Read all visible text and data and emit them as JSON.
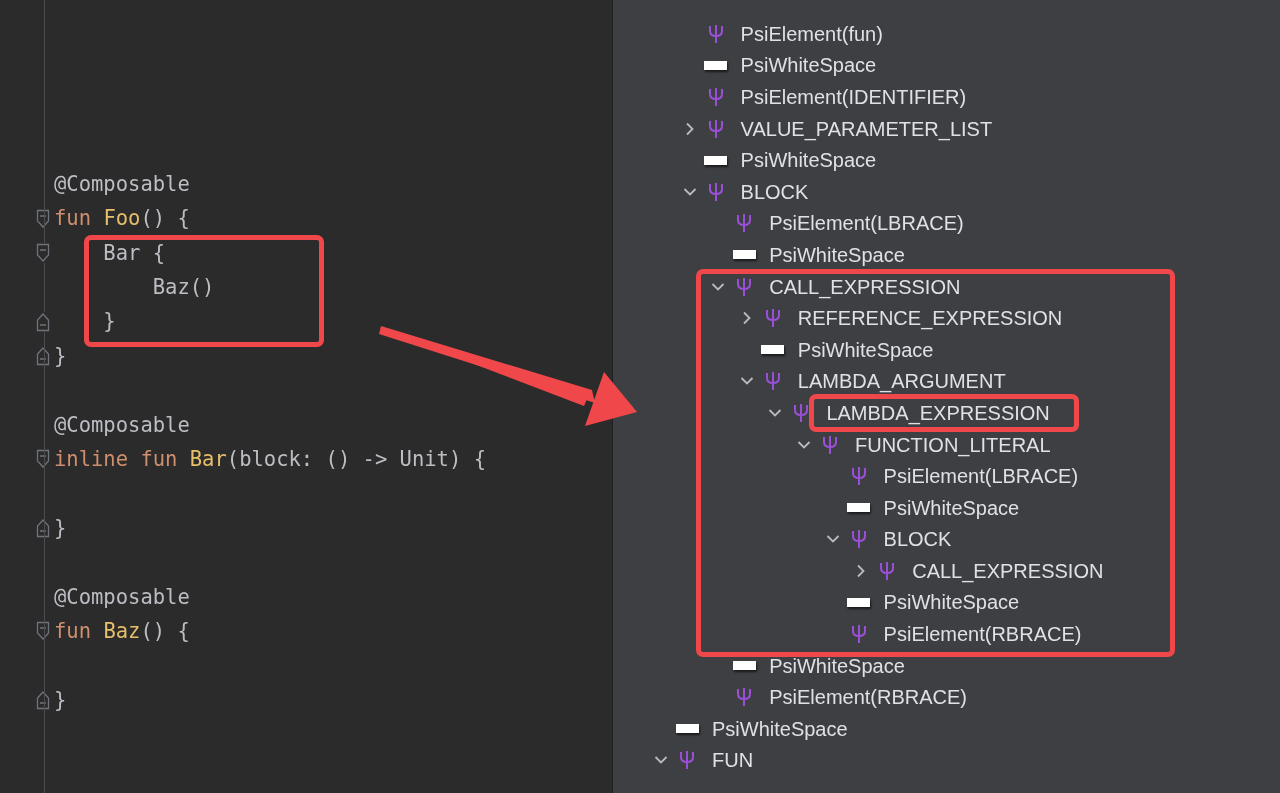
{
  "editor": {
    "lines": [
      {
        "kind": "code",
        "tokens": [
          {
            "text": "@Composable",
            "kind": "annotation"
          }
        ]
      },
      {
        "kind": "code",
        "fold_open": true,
        "tokens": [
          {
            "text": "fun ",
            "kind": "keyword"
          },
          {
            "text": "Foo",
            "kind": "function"
          },
          {
            "text": "() {",
            "kind": "plain"
          }
        ]
      },
      {
        "kind": "code",
        "fold_open": true,
        "highlighted": true,
        "tokens": [
          {
            "text": "    Bar {",
            "kind": "plain"
          }
        ]
      },
      {
        "kind": "code",
        "highlighted": true,
        "tokens": [
          {
            "text": "        Baz()",
            "kind": "plain"
          }
        ]
      },
      {
        "kind": "code",
        "fold_close": true,
        "highlighted": true,
        "tokens": [
          {
            "text": "    }",
            "kind": "plain"
          }
        ]
      },
      {
        "kind": "code",
        "fold_close": true,
        "tokens": [
          {
            "text": "}",
            "kind": "plain"
          }
        ]
      },
      {
        "kind": "blank"
      },
      {
        "kind": "code",
        "tokens": [
          {
            "text": "@Composable",
            "kind": "annotation"
          }
        ]
      },
      {
        "kind": "code",
        "fold_open": true,
        "tokens": [
          {
            "text": "inline fun ",
            "kind": "keyword"
          },
          {
            "text": "Bar",
            "kind": "function"
          },
          {
            "text": "(block: () -> Unit) {",
            "kind": "plain"
          }
        ]
      },
      {
        "kind": "blank"
      },
      {
        "kind": "code",
        "fold_close": true,
        "tokens": [
          {
            "text": "}",
            "kind": "plain"
          }
        ]
      },
      {
        "kind": "blank"
      },
      {
        "kind": "code",
        "tokens": [
          {
            "text": "@Composable",
            "kind": "annotation"
          }
        ]
      },
      {
        "kind": "code",
        "fold_open": true,
        "tokens": [
          {
            "text": "fun ",
            "kind": "keyword"
          },
          {
            "text": "Baz",
            "kind": "function"
          },
          {
            "text": "() {",
            "kind": "plain"
          }
        ]
      },
      {
        "kind": "blank"
      },
      {
        "kind": "code",
        "fold_close": true,
        "tokens": [
          {
            "text": "}",
            "kind": "plain"
          }
        ]
      }
    ]
  },
  "psi_tree": {
    "continued_children": [
      {
        "label": "PsiElement(fun)",
        "kind": "element"
      },
      {
        "label": "PsiWhiteSpace",
        "kind": "whitespace"
      },
      {
        "label": "PsiElement(IDENTIFIER)",
        "kind": "element"
      },
      {
        "label": "VALUE_PARAMETER_LIST",
        "kind": "element",
        "expanded": false
      },
      {
        "label": "PsiWhiteSpace",
        "kind": "whitespace"
      },
      {
        "label": "BLOCK",
        "kind": "element",
        "expanded": true,
        "children": [
          {
            "label": "PsiElement(LBRACE)",
            "kind": "element"
          },
          {
            "label": "PsiWhiteSpace",
            "kind": "whitespace"
          },
          {
            "label": "CALL_EXPRESSION",
            "kind": "element",
            "expanded": true,
            "highlighted": true,
            "children": [
              {
                "label": "REFERENCE_EXPRESSION",
                "kind": "element",
                "expanded": false
              },
              {
                "label": "PsiWhiteSpace",
                "kind": "whitespace"
              },
              {
                "label": "LAMBDA_ARGUMENT",
                "kind": "element",
                "expanded": true,
                "children": [
                  {
                    "label": "LAMBDA_EXPRESSION",
                    "kind": "element",
                    "expanded": true,
                    "label_highlighted": true,
                    "children": [
                      {
                        "label": "FUNCTION_LITERAL",
                        "kind": "element",
                        "expanded": true,
                        "children": [
                          {
                            "label": "PsiElement(LBRACE)",
                            "kind": "element"
                          },
                          {
                            "label": "PsiWhiteSpace",
                            "kind": "whitespace"
                          },
                          {
                            "label": "BLOCK",
                            "kind": "element",
                            "expanded": true,
                            "children": [
                              {
                                "label": "CALL_EXPRESSION",
                                "kind": "element",
                                "expanded": false
                              }
                            ]
                          },
                          {
                            "label": "PsiWhiteSpace",
                            "kind": "whitespace"
                          },
                          {
                            "label": "PsiElement(RBRACE)",
                            "kind": "element"
                          }
                        ]
                      }
                    ]
                  }
                ]
              }
            ]
          },
          {
            "label": "PsiWhiteSpace",
            "kind": "whitespace"
          },
          {
            "label": "PsiElement(RBRACE)",
            "kind": "element"
          }
        ]
      }
    ],
    "nodes": [
      {
        "label": "PsiWhiteSpace",
        "kind": "whitespace"
      },
      {
        "label": "FUN",
        "kind": "element",
        "expanded": true
      }
    ]
  }
}
